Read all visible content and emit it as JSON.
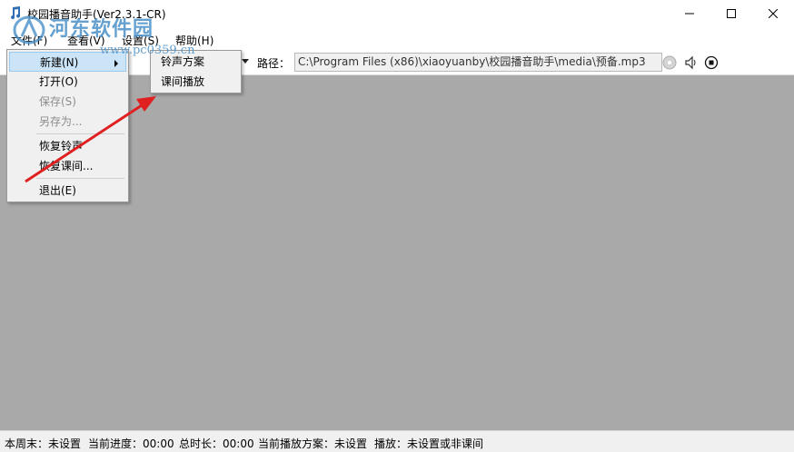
{
  "window": {
    "title": "校园播音助手(Ver2.3.1-CR)",
    "minimize_glyph": "—",
    "maximize_glyph": "☐",
    "close_glyph": "✕"
  },
  "watermark": {
    "text": "河东软件园",
    "url": "www.pc0359.cn"
  },
  "menubar": {
    "items": [
      "文件(F)",
      "查看(V)",
      "设置(S)",
      "帮助(H)"
    ]
  },
  "file_menu": {
    "items": [
      {
        "label": "新建(N)",
        "has_submenu": true,
        "enabled": true,
        "hovered": true
      },
      {
        "label": "打开(O)",
        "enabled": true
      },
      {
        "label": "保存(S)",
        "enabled": false
      },
      {
        "label": "另存为...",
        "enabled": false
      },
      {
        "label": "恢复铃声",
        "enabled": true
      },
      {
        "label": "恢复课间...",
        "enabled": true
      },
      {
        "label": "退出(E)",
        "enabled": true
      }
    ]
  },
  "new_submenu": {
    "items": [
      "铃声方案",
      "课间播放"
    ]
  },
  "toolbar": {
    "path_label": "路径：",
    "path_value": "C:\\Program Files (x86)\\xiaoyuanby\\校园播音助手\\media\\预备.mp3",
    "icons": [
      "disc-icon",
      "speaker-icon",
      "stop-icon"
    ]
  },
  "statusbar": {
    "week": "本周末：未设置",
    "progress": "当前进度：00:00",
    "duration": "总时长：00:00",
    "scheme": "当前播放方案：未设置",
    "play": "播放：未设置或非课间"
  },
  "colors": {
    "workspace": "#a9a9a9",
    "menu_bg": "#f0f0f0",
    "hover": "#cce4f7",
    "annotation_arrow": "#e02020",
    "watermark": "#4a90c8"
  }
}
